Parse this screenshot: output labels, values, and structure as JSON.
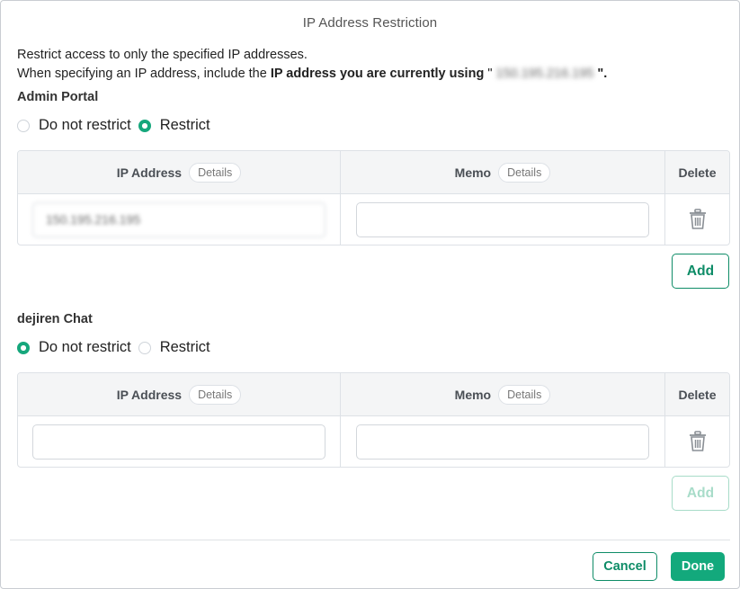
{
  "dialog": {
    "title": "IP Address Restriction",
    "description_line1": "Restrict access to only the specified IP addresses.",
    "description_line2_prefix": "When specifying an IP address, include the ",
    "description_line2_bold": "IP address you are currently using",
    "description_line2_quote_open": " \"",
    "current_ip": "150.195.216.195",
    "description_line2_quote_close": "\"."
  },
  "admin_portal": {
    "title": "Admin Portal",
    "radio_no_restrict": "Do not restrict",
    "radio_restrict": "Restrict",
    "selected": "Restrict",
    "table": {
      "col_ip": "IP Address",
      "col_memo": "Memo",
      "col_delete": "Delete",
      "details_label": "Details",
      "rows": [
        {
          "ip": "150.195.216.195",
          "memo": ""
        }
      ]
    },
    "add_label": "Add"
  },
  "dejiren_chat": {
    "title": "dejiren Chat",
    "radio_no_restrict": "Do not restrict",
    "radio_restrict": "Restrict",
    "selected": "Do not restrict",
    "table": {
      "col_ip": "IP Address",
      "col_memo": "Memo",
      "col_delete": "Delete",
      "details_label": "Details",
      "rows": [
        {
          "ip": "",
          "memo": ""
        }
      ]
    },
    "add_label": "Add"
  },
  "footer": {
    "cancel_label": "Cancel",
    "done_label": "Done"
  },
  "colors": {
    "accent": "#13a97c",
    "accent_text": "#0e8c67",
    "disabled": "#a8dcc9"
  },
  "icons": {
    "delete": "trash-icon"
  }
}
